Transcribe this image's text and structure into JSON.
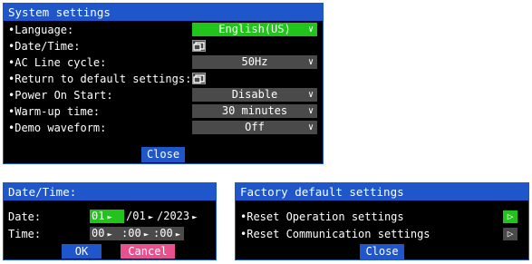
{
  "settings": {
    "title": "System settings",
    "rows": [
      {
        "label": "•Language:",
        "value": "English(US)"
      },
      {
        "label": "•Date/Time:",
        "value": ""
      },
      {
        "label": "•AC Line cycle:",
        "value": "50Hz"
      },
      {
        "label": "•Return to default settings:",
        "value": ""
      },
      {
        "label": "•Power On Start:",
        "value": "Disable"
      },
      {
        "label": "•Warm-up time:",
        "value": "30 minutes"
      },
      {
        "label": "•Demo waveform:",
        "value": "Off"
      }
    ],
    "close_label": "Close"
  },
  "datetime": {
    "title": "Date/Time:",
    "date_label": "Date:",
    "time_label": "Time:",
    "day": "01",
    "month": "/01",
    "year": "/2023",
    "hour": "00",
    "minute": ":00",
    "second": ":00",
    "ok_label": "OK",
    "cancel_label": "Cancel"
  },
  "factory": {
    "title": "Factory default settings",
    "items": [
      {
        "label": "•Reset Operation settings"
      },
      {
        "label": "•Reset Communication settings"
      }
    ],
    "close_label": "Close"
  },
  "colors": {
    "accent_blue": "#1f56c9",
    "highlight_green": "#22c41c",
    "dropdown_grey": "#4a4a4a",
    "cancel_pink": "#e8508f",
    "spin_grey": "#4a4a4a",
    "spin_selected": "#22c41c"
  },
  "icons": [
    "chevron-down-icon",
    "window-icon",
    "right-arrow-icon",
    "play-icon"
  ]
}
